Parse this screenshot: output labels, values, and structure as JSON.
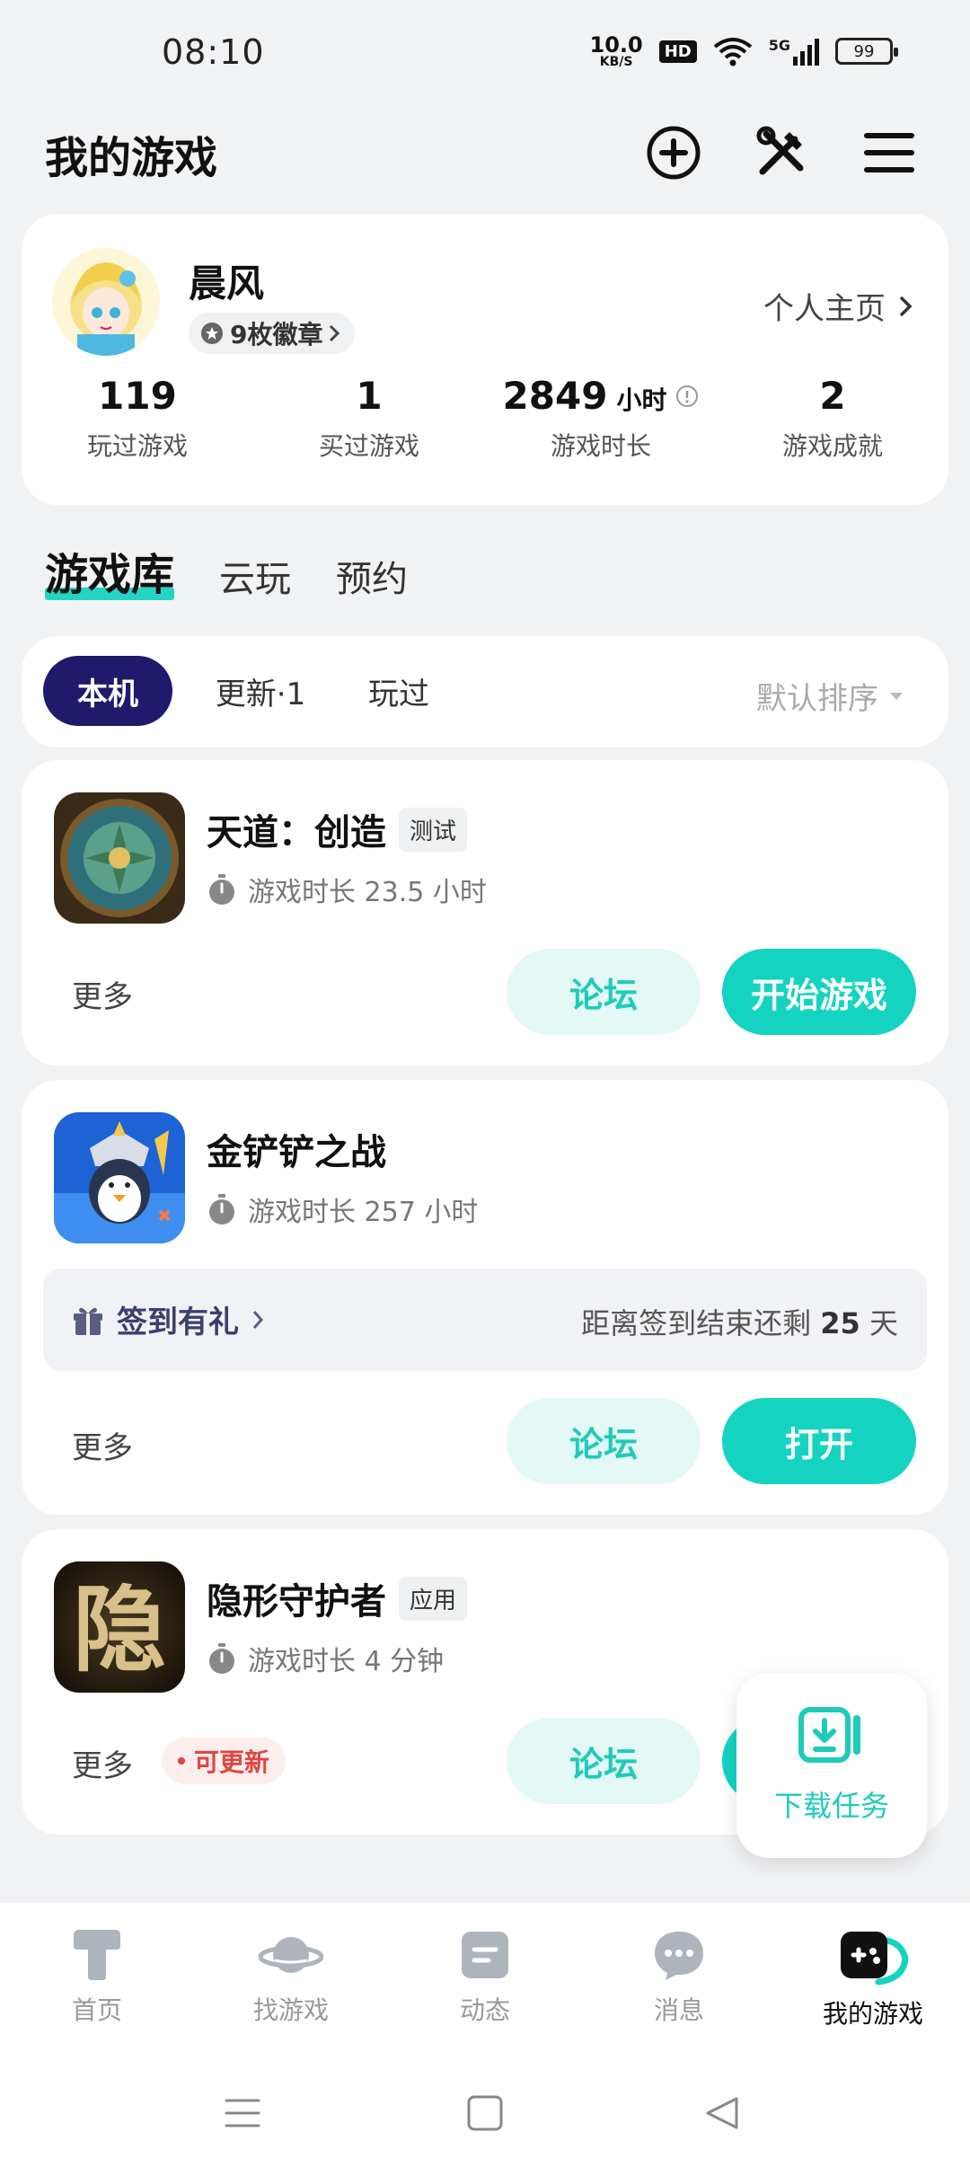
{
  "status": {
    "time": "08:10",
    "net_speed": "10.0",
    "net_unit": "KB/S",
    "hd": "HD",
    "signal": "5G",
    "battery": "99"
  },
  "header": {
    "title": "我的游戏"
  },
  "profile": {
    "name": "晨风",
    "badges": "9枚徽章",
    "home_link": "个人主页",
    "stats": [
      {
        "value": "119",
        "unit": "",
        "label": "玩过游戏"
      },
      {
        "value": "1",
        "unit": "",
        "label": "买过游戏"
      },
      {
        "value": "2849",
        "unit": "小时",
        "label": "游戏时长"
      },
      {
        "value": "2",
        "unit": "",
        "label": "游戏成就"
      }
    ]
  },
  "lib_tabs": [
    "游戏库",
    "云玩",
    "预约"
  ],
  "filters": {
    "chips": [
      "本机",
      "更新·1",
      "玩过"
    ],
    "sort": "默认排序"
  },
  "games": [
    {
      "name": "天道：创造",
      "tag": "测试",
      "playtime": "游戏时长 23.5 小时",
      "more": "更多",
      "forum": "论坛",
      "action": "开始游戏"
    },
    {
      "name": "金铲铲之战",
      "tag": "",
      "playtime": "游戏时长 257 小时",
      "more": "更多",
      "forum": "论坛",
      "action": "打开",
      "checkin": {
        "label": "签到有礼",
        "remain_prefix": "距离签到结束还剩",
        "remain_days": "25",
        "remain_suffix": "天"
      }
    },
    {
      "name": "隐形守护者",
      "tag": "应用",
      "playtime": "游戏时长 4 分钟",
      "more": "更多",
      "update_tag": "可更新",
      "forum": "论坛",
      "icon_char": "隐"
    }
  ],
  "fab": {
    "label": "下载任务"
  },
  "bottom_nav": [
    {
      "label": "首页",
      "icon": "home-icon"
    },
    {
      "label": "找游戏",
      "icon": "planet-icon"
    },
    {
      "label": "动态",
      "icon": "feed-icon"
    },
    {
      "label": "消息",
      "icon": "chat-icon"
    },
    {
      "label": "我的游戏",
      "icon": "gamepad-icon"
    }
  ],
  "colors": {
    "accent": "#14d4c1",
    "accent_light": "#e4f8f6",
    "chip_active": "#1f1a6b",
    "update_red": "#e0463f"
  }
}
